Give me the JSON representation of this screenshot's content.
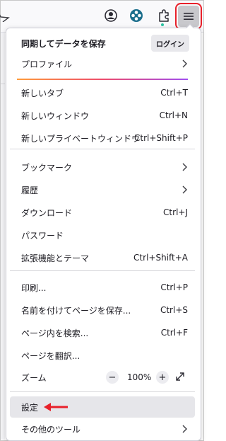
{
  "toolbar": {
    "icons": [
      "star-icon",
      "account-icon",
      "extension-icon",
      "puzzle-icon",
      "hamburger-menu-icon"
    ],
    "accent": "#e8202a"
  },
  "menu": {
    "sync": {
      "title": "同期してデータを保存",
      "login_label": "ログイン"
    },
    "profile": {
      "label": "プロファイル"
    },
    "new_tab": {
      "label": "新しいタブ",
      "shortcut": "Ctrl+T"
    },
    "new_window": {
      "label": "新しいウィンドウ",
      "shortcut": "Ctrl+N"
    },
    "new_private_window": {
      "label": "新しいプライベートウィンドウ",
      "shortcut": "Ctrl+Shift+P"
    },
    "bookmarks": {
      "label": "ブックマーク"
    },
    "history": {
      "label": "履歴"
    },
    "downloads": {
      "label": "ダウンロード",
      "shortcut": "Ctrl+J"
    },
    "passwords": {
      "label": "パスワード"
    },
    "addons": {
      "label": "拡張機能とテーマ",
      "shortcut": "Ctrl+Shift+A"
    },
    "print": {
      "label": "印刷...",
      "shortcut": "Ctrl+P"
    },
    "save_page": {
      "label": "名前を付けてページを保存...",
      "shortcut": "Ctrl+S"
    },
    "find": {
      "label": "ページ内を検索...",
      "shortcut": "Ctrl+F"
    },
    "translate": {
      "label": "ページを翻訳..."
    },
    "zoom": {
      "label": "ズーム",
      "minus": "−",
      "level": "100%",
      "plus": "+"
    },
    "settings": {
      "label": "設定"
    },
    "more_tools": {
      "label": "その他のツール"
    }
  }
}
